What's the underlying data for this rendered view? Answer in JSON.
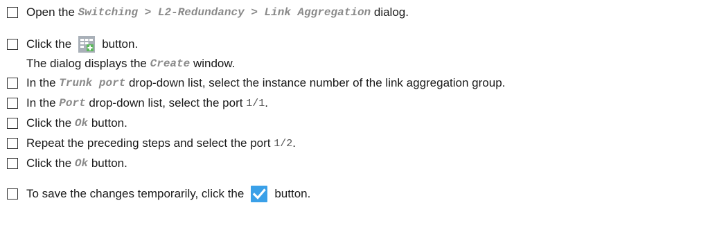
{
  "steps": [
    {
      "pre": "Open the ",
      "ui": "Switching > L2-Redundancy > Link Aggregation",
      "post": " dialog."
    },
    {
      "pre": "Click the",
      "post": "button.",
      "icon": "create-table-icon"
    },
    {
      "note_pre": "The dialog displays the ",
      "note_ui": "Create",
      "note_post": " window."
    },
    {
      "pre": "In the ",
      "ui": "Trunk port",
      "post": " drop-down list, select the instance number of the link aggregation group."
    },
    {
      "pre": "In the ",
      "ui": "Port",
      "mid": " drop-down list, select the port ",
      "val": "1/1",
      "post": "."
    },
    {
      "pre": "Click the ",
      "ui": "Ok",
      "post": " button."
    },
    {
      "pre": "Repeat the preceding steps and select the port ",
      "val": "1/2",
      "post": "."
    },
    {
      "pre": "Click the ",
      "ui": "Ok",
      "post": " button."
    },
    {
      "pre": "To save the changes temporarily, click the",
      "post": "button.",
      "icon": "checkmark-save-icon"
    }
  ],
  "colors": {
    "text": "#1a1a1a",
    "ui_reference": "#8a8a8a",
    "value": "#555555",
    "checkmark_bg": "#3aa0e8"
  }
}
